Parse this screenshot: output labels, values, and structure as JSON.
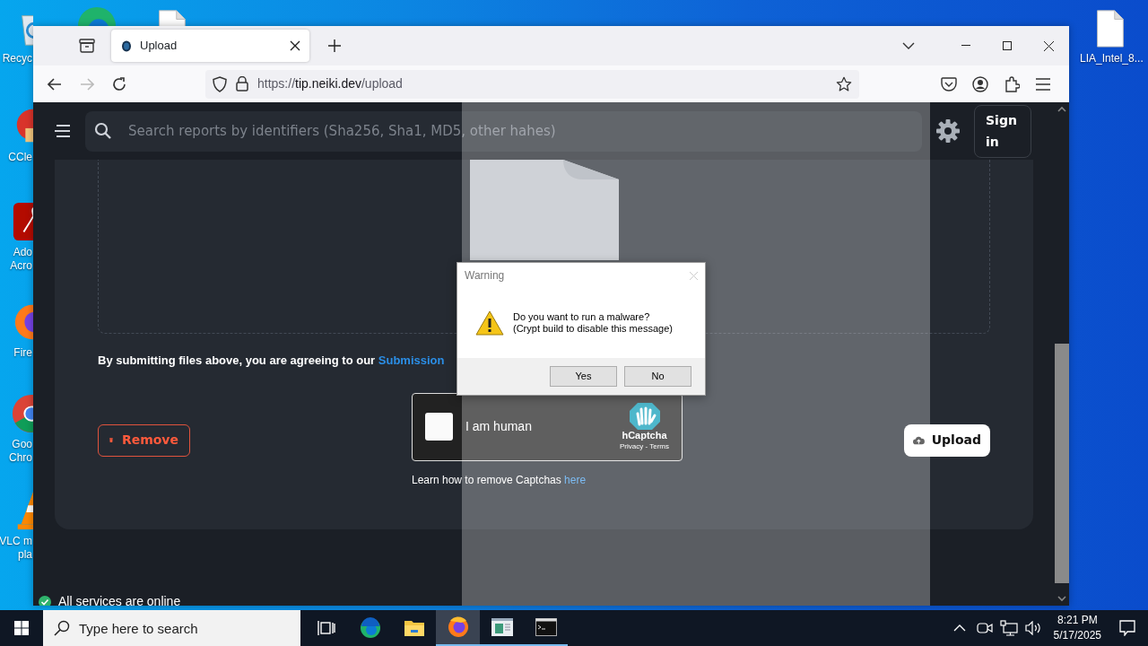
{
  "desktop": {
    "icons": [
      {
        "kind": "recycle-bin",
        "label_lines": [
          "Recyc"
        ]
      },
      {
        "kind": "edge"
      },
      {
        "kind": "document"
      },
      {
        "kind": "ccleaner",
        "label_lines": [
          "CCle"
        ]
      },
      {
        "kind": "acrobat",
        "label_lines": [
          "Ado",
          "Acro"
        ]
      },
      {
        "kind": "firefox",
        "label_lines": [
          "Fire"
        ]
      },
      {
        "kind": "chrome",
        "label_lines": [
          "Goo",
          "Chro"
        ]
      },
      {
        "kind": "vlc",
        "label_lines": [
          "VLC m",
          "pla"
        ]
      },
      {
        "kind": "document",
        "label_lines": [
          "LIA_Intel_8..."
        ]
      }
    ]
  },
  "browser": {
    "tabs": [
      {
        "title": "Upload",
        "selected": true
      }
    ],
    "url": {
      "scheme": "https://",
      "host": "tip.neiki.dev",
      "path": "/upload"
    }
  },
  "page": {
    "search": {
      "placeholder": "Search reports by identifiers (Sha256, Sha1, MD5, other hahes)"
    },
    "sign_in": "Sign in",
    "notice": {
      "text": "By submitting files above, you are agreeing to our ",
      "link": "Submission"
    },
    "remove_button": "Remove",
    "captcha": {
      "label": "I am human",
      "checked": false,
      "brand": "hCaptcha",
      "links": "Privacy - Terms"
    },
    "captcha_help": {
      "text": "Learn how to remove Captchas ",
      "link": "here"
    },
    "upload_button": "Upload",
    "status": "All services are online"
  },
  "dialog": {
    "title": "Warning",
    "message": [
      "Do you want to run a malware?",
      "(Crypt build to disable this message)"
    ],
    "buttons": [
      "Yes",
      "No"
    ]
  },
  "taskbar": {
    "search_placeholder": "Type here to search",
    "apps": [
      {
        "kind": "task-view",
        "selected": false,
        "running": false
      },
      {
        "kind": "edge",
        "selected": false,
        "running": false
      },
      {
        "kind": "explorer",
        "selected": false,
        "running": false
      },
      {
        "kind": "firefox",
        "selected": true,
        "running": true
      },
      {
        "kind": "app-window",
        "selected": false,
        "running": true
      },
      {
        "kind": "terminal",
        "selected": false,
        "running": true
      }
    ],
    "time": "8:21 PM",
    "date": "5/17/2025"
  }
}
